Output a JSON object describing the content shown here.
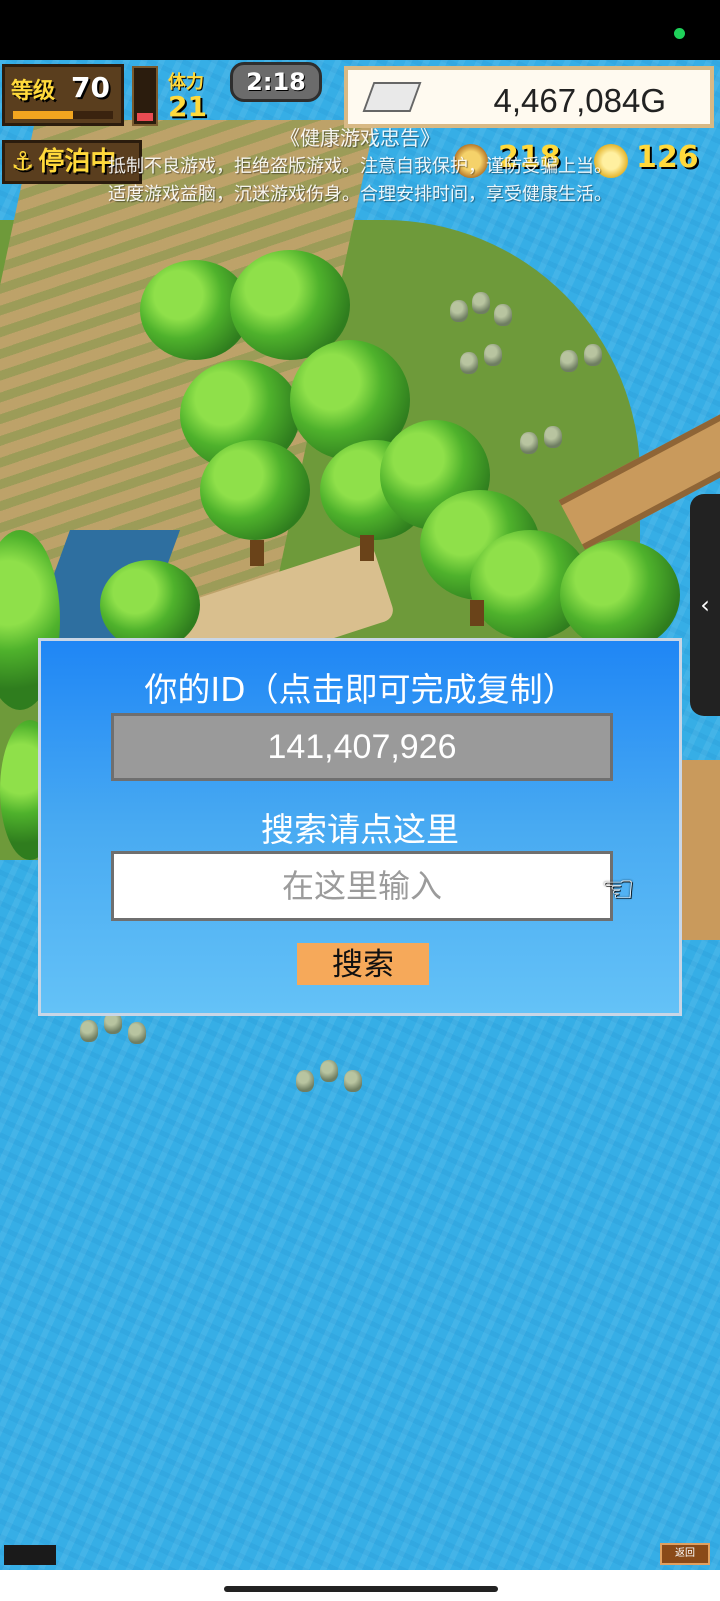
{
  "hud": {
    "level_label": "等级",
    "level_value": "70",
    "level_progress": 0.6,
    "energy_fill": 0.25,
    "stamina_label": "体力",
    "stamina_value": "21",
    "time": "2:18",
    "gold": "4,467,084G",
    "status_label": "停泊中",
    "medals": "218",
    "coins": "126"
  },
  "notice": {
    "title": "《健康游戏忠告》",
    "line1": "抵制不良游戏，拒绝盗版游戏。注意自我保护，谨防受骗上当。",
    "line2": "适度游戏益脑，沉迷游戏伤身。合理安排时间，享受健康生活。"
  },
  "dialog": {
    "title": "你的ID（点击即可完成复制）",
    "id_value": "141,407,926",
    "search_label": "搜索请点这里",
    "search_placeholder": "在这里输入",
    "search_button": "搜索"
  },
  "side_tab": {
    "icon": "chevron-left-icon",
    "glyph": "‹"
  },
  "back_button": "返回",
  "colors": {
    "dialog_top": "#1f86f5",
    "dialog_bottom": "#64c2f7",
    "search_button": "#f6a95a",
    "sea": "#36aee6"
  }
}
